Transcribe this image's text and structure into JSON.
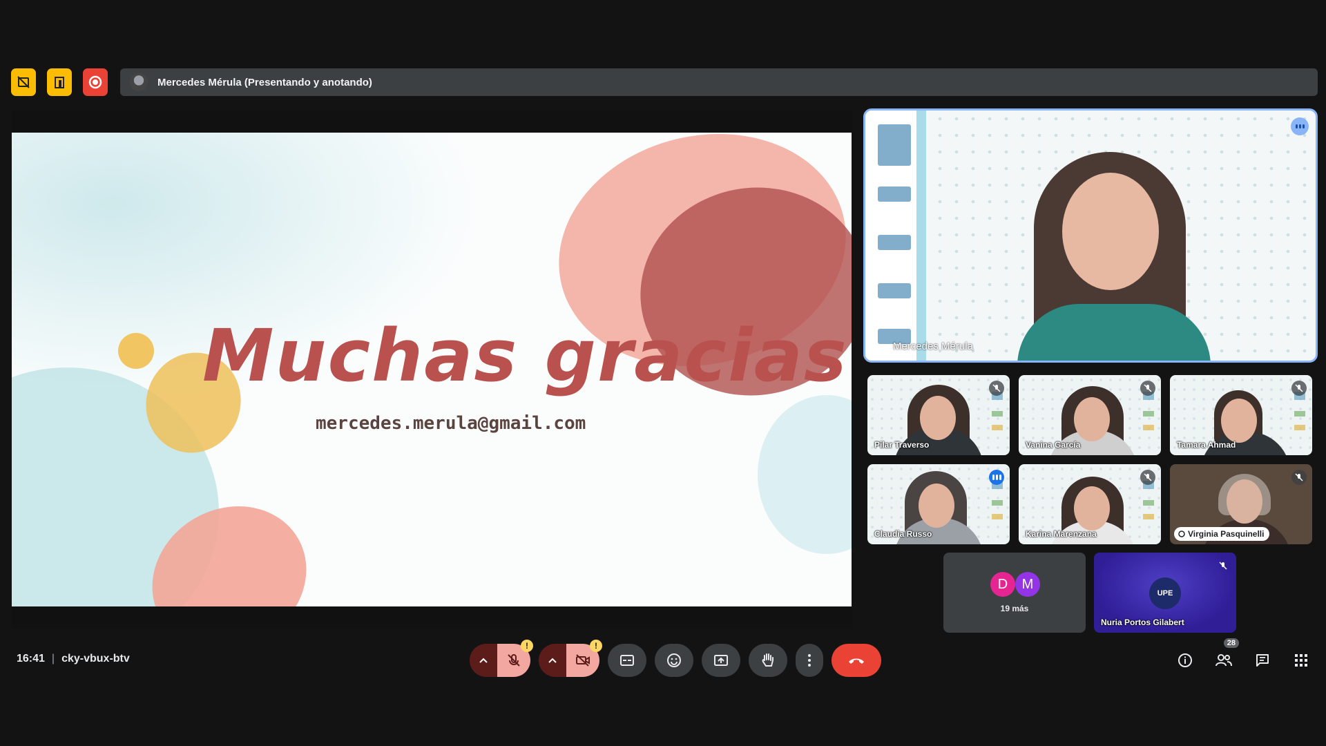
{
  "topbar": {
    "buttons": [
      {
        "icon": "hide-tiles-icon",
        "color": "#fbbc04"
      },
      {
        "icon": "companion-icon",
        "color": "#fbbc04"
      },
      {
        "icon": "recording-icon",
        "color": "#ea4335"
      }
    ],
    "banner_text": "Mercedes Mérula (Presentando y anotando)"
  },
  "slide": {
    "title": "Muchas gracias",
    "email": "mercedes.merula@gmail.com"
  },
  "speaker": {
    "name": "Mercedes Mérula"
  },
  "participants": [
    {
      "name": "Pilar Traverso",
      "state": "muted"
    },
    {
      "name": "Vanina García",
      "state": "muted"
    },
    {
      "name": "Tamara Ahmad",
      "state": "muted"
    },
    {
      "name": "Claudia Russo",
      "state": "speaking"
    },
    {
      "name": "Karina Marenzana",
      "state": "muted"
    },
    {
      "name": "Virginia Pasquinelli",
      "state": "muted"
    }
  ],
  "more": {
    "avatars": [
      "D",
      "M"
    ],
    "label": "19 más"
  },
  "nuria": {
    "name": "Nuria Portos Gilabert",
    "avatar_text": "UPE"
  },
  "meeting": {
    "time": "16:41",
    "separator": "|",
    "code": "cky-vbux-btv"
  },
  "controls": {
    "warn_mark": "!",
    "people_count": "28"
  },
  "colors": {
    "accent": "#8ab4f8",
    "end_call": "#ea4335",
    "muted_control": "#f2a7a1"
  }
}
